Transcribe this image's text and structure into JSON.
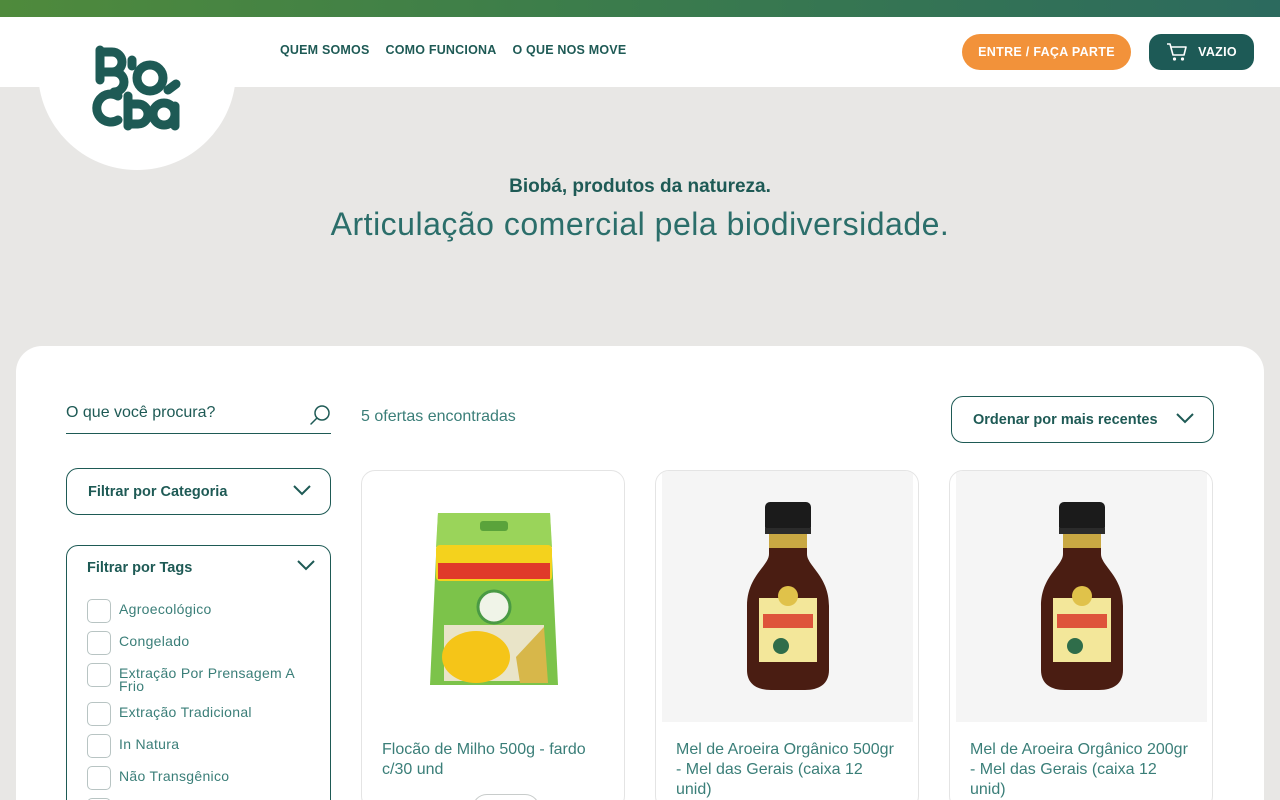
{
  "header": {
    "logo_alt": "Biobá",
    "nav": [
      "QUEM SOMOS",
      "COMO FUNCIONA",
      "O QUE NOS MOVE"
    ],
    "join_label": "ENTRE / FAÇA PARTE",
    "cart_label": "VAZIO"
  },
  "hero": {
    "title": "Biobá, produtos da natureza.",
    "subtitle": "Articulação comercial pela biodiversidade."
  },
  "search": {
    "placeholder": "O que você procura?"
  },
  "results": {
    "count_text": "5 ofertas encontradas"
  },
  "sort": {
    "label": "Ordenar por mais recentes"
  },
  "filters": {
    "category_label": "Filtrar por Categoria",
    "tags_label": "Filtrar por Tags",
    "tags": [
      "Agroecológico",
      "Congelado",
      "Extração Por Prensagem A Frio",
      "Extração Tradicional",
      "In Natura",
      "Não Transgênico"
    ]
  },
  "products": [
    {
      "title": "Flocão de Milho 500g - fardo c/30 und",
      "image": "corn-flour-package"
    },
    {
      "title": "Mel de Aroeira Orgânico 500gr - Mel das Gerais (caixa 12 unid)",
      "image": "honey-bottle"
    },
    {
      "title": "Mel de Aroeira Orgânico 200gr - Mel das Gerais (caixa 12 unid)",
      "image": "honey-bottle"
    }
  ],
  "colors": {
    "brand_dark": "#1e5a55",
    "accent_orange": "#f2923a",
    "background": "#e8e7e5"
  }
}
